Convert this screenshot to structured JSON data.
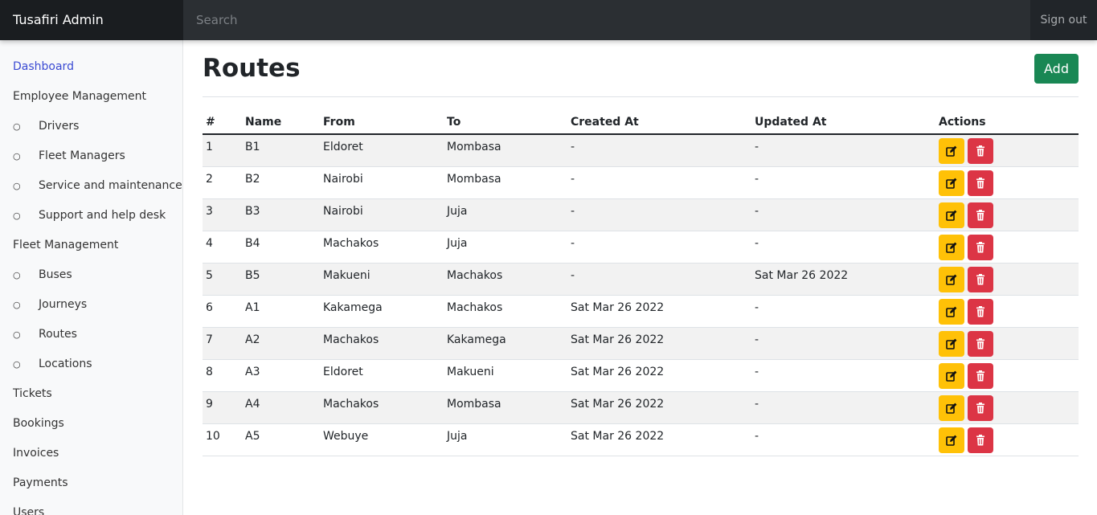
{
  "header": {
    "brand": "Tusafiri Admin",
    "search_placeholder": "Search",
    "signout_label": "Sign out"
  },
  "sidebar": {
    "items": [
      {
        "label": "Dashboard",
        "sub": false,
        "active": true
      },
      {
        "label": "Employee Management",
        "sub": false
      },
      {
        "label": "Drivers",
        "sub": true
      },
      {
        "label": "Fleet Managers",
        "sub": true
      },
      {
        "label": "Service and maintenance",
        "sub": true
      },
      {
        "label": "Support and help desk",
        "sub": true
      },
      {
        "label": "Fleet Management",
        "sub": false
      },
      {
        "label": "Buses",
        "sub": true
      },
      {
        "label": "Journeys",
        "sub": true
      },
      {
        "label": "Routes",
        "sub": true
      },
      {
        "label": "Locations",
        "sub": true
      },
      {
        "label": "Tickets",
        "sub": false
      },
      {
        "label": "Bookings",
        "sub": false
      },
      {
        "label": "Invoices",
        "sub": false
      },
      {
        "label": "Payments",
        "sub": false
      },
      {
        "label": "Users",
        "sub": false
      }
    ],
    "bullet": "○"
  },
  "main": {
    "title": "Routes",
    "add_label": "Add",
    "table": {
      "headers": [
        "#",
        "Name",
        "From",
        "To",
        "Created At",
        "Updated At",
        "Actions"
      ],
      "rows": [
        [
          "1",
          "B1",
          "Eldoret",
          "Mombasa",
          "-",
          "-"
        ],
        [
          "2",
          "B2",
          "Nairobi",
          "Mombasa",
          "-",
          "-"
        ],
        [
          "3",
          "B3",
          "Nairobi",
          "Juja",
          "-",
          "-"
        ],
        [
          "4",
          "B4",
          "Machakos",
          "Juja",
          "-",
          "-"
        ],
        [
          "5",
          "B5",
          "Makueni",
          "Machakos",
          "-",
          "Sat Mar 26 2022"
        ],
        [
          "6",
          "A1",
          "Kakamega",
          "Machakos",
          "Sat Mar 26 2022",
          "-"
        ],
        [
          "7",
          "A2",
          "Machakos",
          "Kakamega",
          "Sat Mar 26 2022",
          "-"
        ],
        [
          "8",
          "A3",
          "Eldoret",
          "Makueni",
          "Sat Mar 26 2022",
          "-"
        ],
        [
          "9",
          "A4",
          "Machakos",
          "Mombasa",
          "Sat Mar 26 2022",
          "-"
        ],
        [
          "10",
          "A5",
          "Webuye",
          "Juja",
          "Sat Mar 26 2022",
          "-"
        ]
      ]
    }
  },
  "colors": {
    "topbar": "#212529",
    "active_link": "#3b4bd3",
    "add_button": "#198754",
    "edit_button": "#ffc107",
    "delete_button": "#dc3545"
  },
  "icons": {
    "edit": "edit-icon",
    "delete": "trash-icon"
  }
}
